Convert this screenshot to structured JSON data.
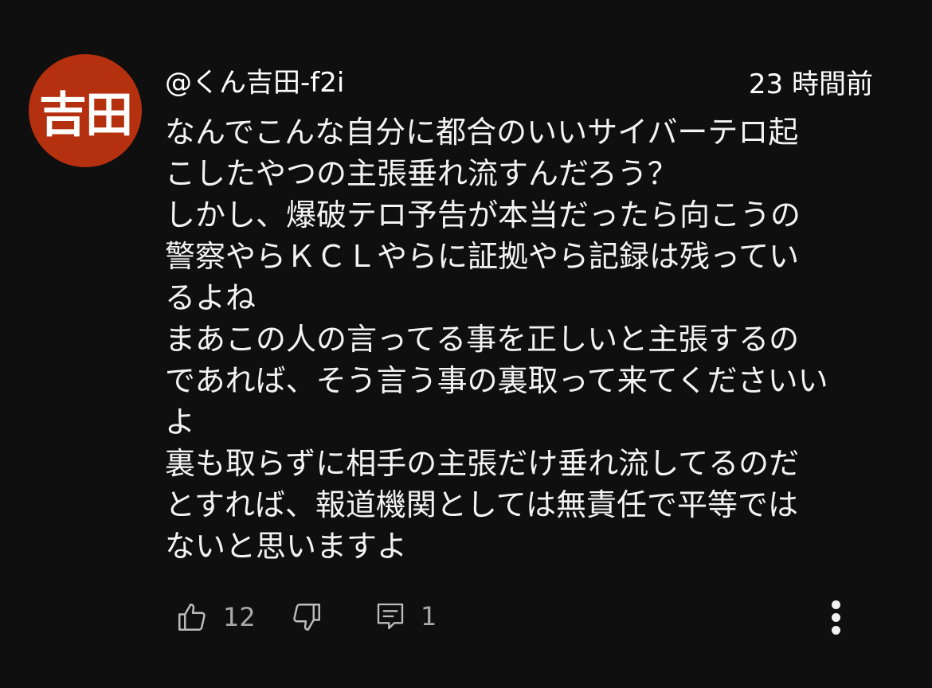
{
  "comment": {
    "avatar_text": "吉田",
    "avatar_color": "#b5300f",
    "author": "@くん吉田-f2i",
    "timestamp": "23 時間前",
    "lines": [
      "なんでこんな自分に都合のいいサイバーテロ起",
      "こしたやつの主張垂れ流すんだろう？",
      "しかし、爆破テロ予告が本当だったら向こうの",
      "警察やらＫＣＬやらに証拠やら記録は残ってい",
      "るよね",
      "まあこの人の言ってる事を正しいと主張するの",
      "であれば、そう言う事の裏取って来てくださいい",
      "よ",
      "裏も取らずに相手の主張だけ垂れ流してるのだ",
      "とすれば、報道機関としては無責任で平等では",
      "ないと思いますよ"
    ]
  },
  "actions": {
    "like_icon": "thumbs-up-icon",
    "like_count": "12",
    "dislike_icon": "thumbs-down-icon",
    "reply_icon": "reply-comment-icon",
    "reply_count": "1",
    "more_icon": "more-vertical-icon"
  }
}
